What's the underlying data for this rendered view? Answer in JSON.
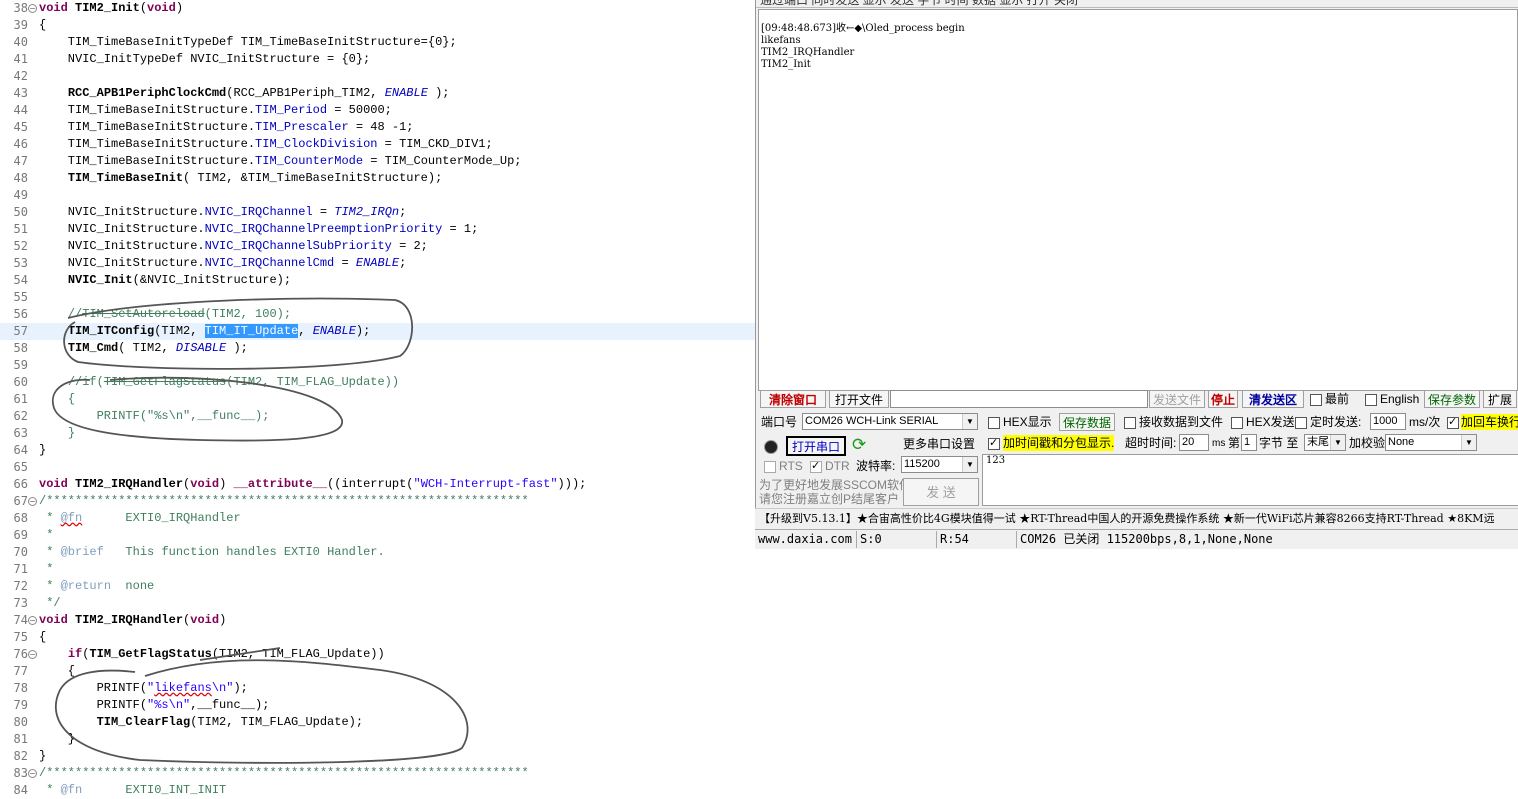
{
  "editor": {
    "lines": [
      {
        "n": "38",
        "fold": "−",
        "html": "<span class=\"k\">void</span> <span class=\"f\">TIM2_Init</span>(<span class=\"k\">void</span>)"
      },
      {
        "n": "39",
        "html": "{"
      },
      {
        "n": "40",
        "html": "    TIM_TimeBaseInitTypeDef TIM_TimeBaseInitStructure={0};"
      },
      {
        "n": "41",
        "html": "    NVIC_InitTypeDef NVIC_InitStructure = {0};"
      },
      {
        "n": "42",
        "html": ""
      },
      {
        "n": "43",
        "html": "    <span class=\"f\">RCC_APB1PeriphClockCmd</span>(RCC_APB1Periph_TIM2, <span class=\"e\">ENABLE</span> );"
      },
      {
        "n": "44",
        "html": "    TIM_TimeBaseInitStructure.<span class=\"m\">TIM_Period</span> = 50000;"
      },
      {
        "n": "45",
        "html": "    TIM_TimeBaseInitStructure.<span class=\"m\">TIM_Prescaler</span> = 48 -1;"
      },
      {
        "n": "46",
        "html": "    TIM_TimeBaseInitStructure.<span class=\"m\">TIM_ClockDivision</span> = TIM_CKD_DIV1;"
      },
      {
        "n": "47",
        "html": "    TIM_TimeBaseInitStructure.<span class=\"m\">TIM_CounterMode</span> = TIM_CounterMode_Up;"
      },
      {
        "n": "48",
        "html": "    <span class=\"f\">TIM_TimeBaseInit</span>( TIM2, &amp;TIM_TimeBaseInitStructure);"
      },
      {
        "n": "49",
        "html": ""
      },
      {
        "n": "50",
        "html": "    NVIC_InitStructure.<span class=\"m\">NVIC_IRQChannel</span> = <span class=\"e\">TIM2_IRQn</span>;"
      },
      {
        "n": "51",
        "html": "    NVIC_InitStructure.<span class=\"m\">NVIC_IRQChannelPreemptionPriority</span> = 1;"
      },
      {
        "n": "52",
        "html": "    NVIC_InitStructure.<span class=\"m\">NVIC_IRQChannelSubPriority</span> = 2;"
      },
      {
        "n": "53",
        "html": "    NVIC_InitStructure.<span class=\"m\">NVIC_IRQChannelCmd</span> = <span class=\"e\">ENABLE</span>;"
      },
      {
        "n": "54",
        "html": "    <span class=\"f\">NVIC_Init</span>(&amp;NVIC_InitStructure);"
      },
      {
        "n": "55",
        "html": ""
      },
      {
        "n": "56",
        "html": "    <span class=\"c\">//<span class=\"strike\">TIM_SetAutoreload</span>(TIM2, 100);</span>"
      },
      {
        "n": "57",
        "cur": true,
        "html": "    <span class=\"f\">TIM_ITConfig</span>(TIM2, <span class=\"sel\">TIM_IT_Update</span>, <span class=\"e\">ENABLE</span>);"
      },
      {
        "n": "58",
        "html": "    <span class=\"f\">TIM_Cmd</span>( TIM2, <span class=\"e\">DISABLE</span> );"
      },
      {
        "n": "59",
        "html": ""
      },
      {
        "n": "60",
        "html": "    <span class=\"c\">//if(<span class=\"strike\">TIM_GetFlagStatus</span>(TIM2, TIM_FLAG_Update))</span>"
      },
      {
        "n": "61",
        "html": "    <span class=\"c\">{</span>"
      },
      {
        "n": "62",
        "html": "        <span class=\"c\">PRINTF(\"%s\\n\",__func__);</span>"
      },
      {
        "n": "63",
        "html": "    <span class=\"c\">}</span>"
      },
      {
        "n": "64",
        "html": "}"
      },
      {
        "n": "65",
        "html": ""
      },
      {
        "n": "66",
        "html": "<span class=\"k\">void</span> <span class=\"f\">TIM2_IRQHandler</span>(<span class=\"k\">void</span>) <span class=\"k\">__attribute__</span>((interrupt(<span class=\"s\">\"WCH-Interrupt-fast\"</span>)));"
      },
      {
        "n": "67",
        "fold": "−",
        "html": "<span class=\"c\">/*******************************************************************</span>"
      },
      {
        "n": "68",
        "html": "<span class=\"c\"> * <span class=\"doc squig\">@fn</span>      EXTI0_IRQHandler</span>"
      },
      {
        "n": "69",
        "html": "<span class=\"c\"> *</span>"
      },
      {
        "n": "70",
        "html": "<span class=\"c\"> * <span class=\"doc\">@brief</span>   This function handles EXTI0 Handler.</span>"
      },
      {
        "n": "71",
        "html": "<span class=\"c\"> *</span>"
      },
      {
        "n": "72",
        "html": "<span class=\"c\"> * <span class=\"doc\">@return</span>  none</span>"
      },
      {
        "n": "73",
        "html": "<span class=\"c\"> */</span>"
      },
      {
        "n": "74",
        "fold": "−",
        "html": "<span class=\"k\">void</span> <span class=\"f\">TIM2_IRQHandler</span>(<span class=\"k\">void</span>)"
      },
      {
        "n": "75",
        "html": "{"
      },
      {
        "n": "76",
        "fold": "−",
        "html": "    <span class=\"k\">if</span>(<span class=\"f\">TIM_GetFlagStatus</span>(TIM2, TIM_FLAG_Update))"
      },
      {
        "n": "77",
        "html": "    {"
      },
      {
        "n": "78",
        "html": "        PRINTF(<span class=\"s\">\"<span class=\"squig\">likefans</span>\\n\"</span>);"
      },
      {
        "n": "79",
        "html": "        PRINTF(<span class=\"s\">\"%s\\n\"</span>,__func__);"
      },
      {
        "n": "80",
        "html": "        <span class=\"f\">TIM_ClearFlag</span>(TIM2, TIM_FLAG_Update);"
      },
      {
        "n": "81",
        "html": "    }"
      },
      {
        "n": "82",
        "html": "}"
      },
      {
        "n": "83",
        "fold": "−",
        "html": "<span class=\"c\">/*******************************************************************</span>"
      },
      {
        "n": "84",
        "html": "<span class=\"c\"> * <span class=\"doc\">@fn</span>      EXTI0_INT_INIT</span>"
      }
    ]
  },
  "serial": {
    "title": "通过端口    同时发送    显示    发送    字节    时间    数据    显示    打开    关闭",
    "receive_lines": [
      "[09:48:48.673]收←◆\\Oled_process begin",
      "likefans",
      "TIM2_IRQHandler",
      "TIM2_Init"
    ],
    "toolbar": {
      "clear_window": "清除窗口",
      "open_file": "打开文件",
      "send_file": "发送文件",
      "stop": "停止",
      "clear_send": "清发送区",
      "topmost": "最前",
      "english": "English",
      "save_params": "保存参数",
      "expand": "扩展"
    },
    "settings": {
      "port_label": "端口号",
      "port_value": "COM26 WCH-Link SERIAL",
      "hex_display": "HEX显示",
      "save_data": "保存数据",
      "receive_to_file": "接收数据到文件",
      "hex_send": "HEX发送",
      "timed_send": "定时发送:",
      "interval_value": "1000",
      "interval_unit": "ms/次",
      "add_crlf": "加回车换行",
      "open_port": "打开串口",
      "more_settings": "更多串口设置",
      "timestamp": "加时间戳和分包显示.",
      "timeout_label": "超时时间:",
      "timeout_value": "20",
      "timeout_unit": "ms",
      "nth_label": "第",
      "nth_value": "1",
      "byte_to": "字节 至",
      "end_value": "末尾",
      "checksum_label": "加校验",
      "checksum_value": "None",
      "rts": "RTS",
      "dtr": "DTR",
      "baud_label": "波特率:",
      "baud_value": "115200",
      "promo": "为了更好地发展SSCOM软件\n请您注册嘉立创P结尾客户",
      "send_button": "发 送",
      "send_text": "123"
    },
    "marquee": "【升级到V5.13.1】★合宙高性价比4G模块值得一试 ★RT-Thread中国人的开源免费操作系统 ★新一代WiFi芯片兼容8266支持RT-Thread ★8KM远",
    "status": {
      "site": "www.daxia.com",
      "sent": "S:0",
      "received": "R:54",
      "port_state": "COM26 已关闭  115200bps,8,1,None,None"
    }
  },
  "colors": {
    "annotation_ink": "#555555",
    "current_line": "#e8f2fe",
    "selection": "#3399ff",
    "keyword": "#7f0055",
    "member": "#0000c0"
  }
}
